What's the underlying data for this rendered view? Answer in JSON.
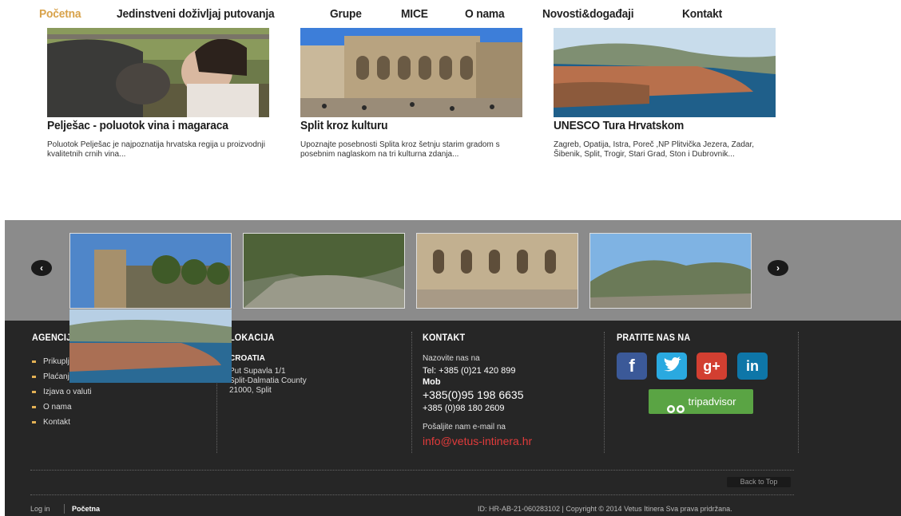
{
  "nav": {
    "items": [
      "Početna",
      "Jedinstveni doživljaj putovanja",
      "Grupe",
      "MICE",
      "O nama",
      "Novosti&događaji",
      "Kontakt"
    ]
  },
  "cards": [
    {
      "title": "Pelješac - poluotok vina i magaraca",
      "desc": "Poluotok Pelješac je najpoznatija hrvatska regija u proizvodnji kvalitetnih crnih vina..."
    },
    {
      "title": "Split kroz kulturu",
      "desc": "Upoznajte posebnosti Splita kroz šetnju starim gradom s posebnim naglaskom na tri kulturna zdanja..."
    },
    {
      "title": "UNESCO Tura Hrvatskom",
      "desc": "Zagreb, Opatija, Istra, Poreč ,NP Plitvička Jezera, Zadar, Šibenik, Split, Trogir, Stari Grad, Ston i Dubrovnik..."
    }
  ],
  "carousel": {
    "prev": "‹",
    "next": "›"
  },
  "footer": {
    "agencija": {
      "heading": "AGENCIJA",
      "links": [
        "Prikupljanje podataka",
        "Plaćanje",
        "Izjava o valuti",
        "O nama",
        "Kontakt"
      ]
    },
    "lokacija": {
      "heading": "LOKACIJA",
      "country": "CROATIA",
      "line1": "Put Supavla 1/1",
      "line2": "Split-Dalmatia County",
      "line3": "21000, Split"
    },
    "kontakt": {
      "heading": "KONTAKT",
      "call_label": "Nazovite nas na",
      "tel": "Tel: +385 (0)21 420 899",
      "mob_label": "Mob",
      "mob1": "+385(0)95 198 6635",
      "mob2": "+385 (0)98 180 2609",
      "mail_label": "Pošaljite nam e-mail na",
      "email": "info@vetus-intinera.hr"
    },
    "pratite": {
      "heading": "PRATITE NAS NA",
      "tripadvisor": "tripadvisor"
    },
    "back_to_top": "Back to Top",
    "login": "Log in",
    "home": "Početna",
    "copyright": "ID: HR-AB-21-060283102 | Copyright © 2014 Vetus Itinera Sva prava pridržana."
  },
  "colors": {
    "accent": "#d8a24a",
    "email": "#e23b3b",
    "footer_bg": "#262626",
    "carousel_bg": "#8b8b8b",
    "facebook": "#3b5998",
    "twitter": "#2aa9e0",
    "gplus": "#d23f31",
    "linkedin": "#0e76a8",
    "tripadvisor": "#5aa444"
  }
}
